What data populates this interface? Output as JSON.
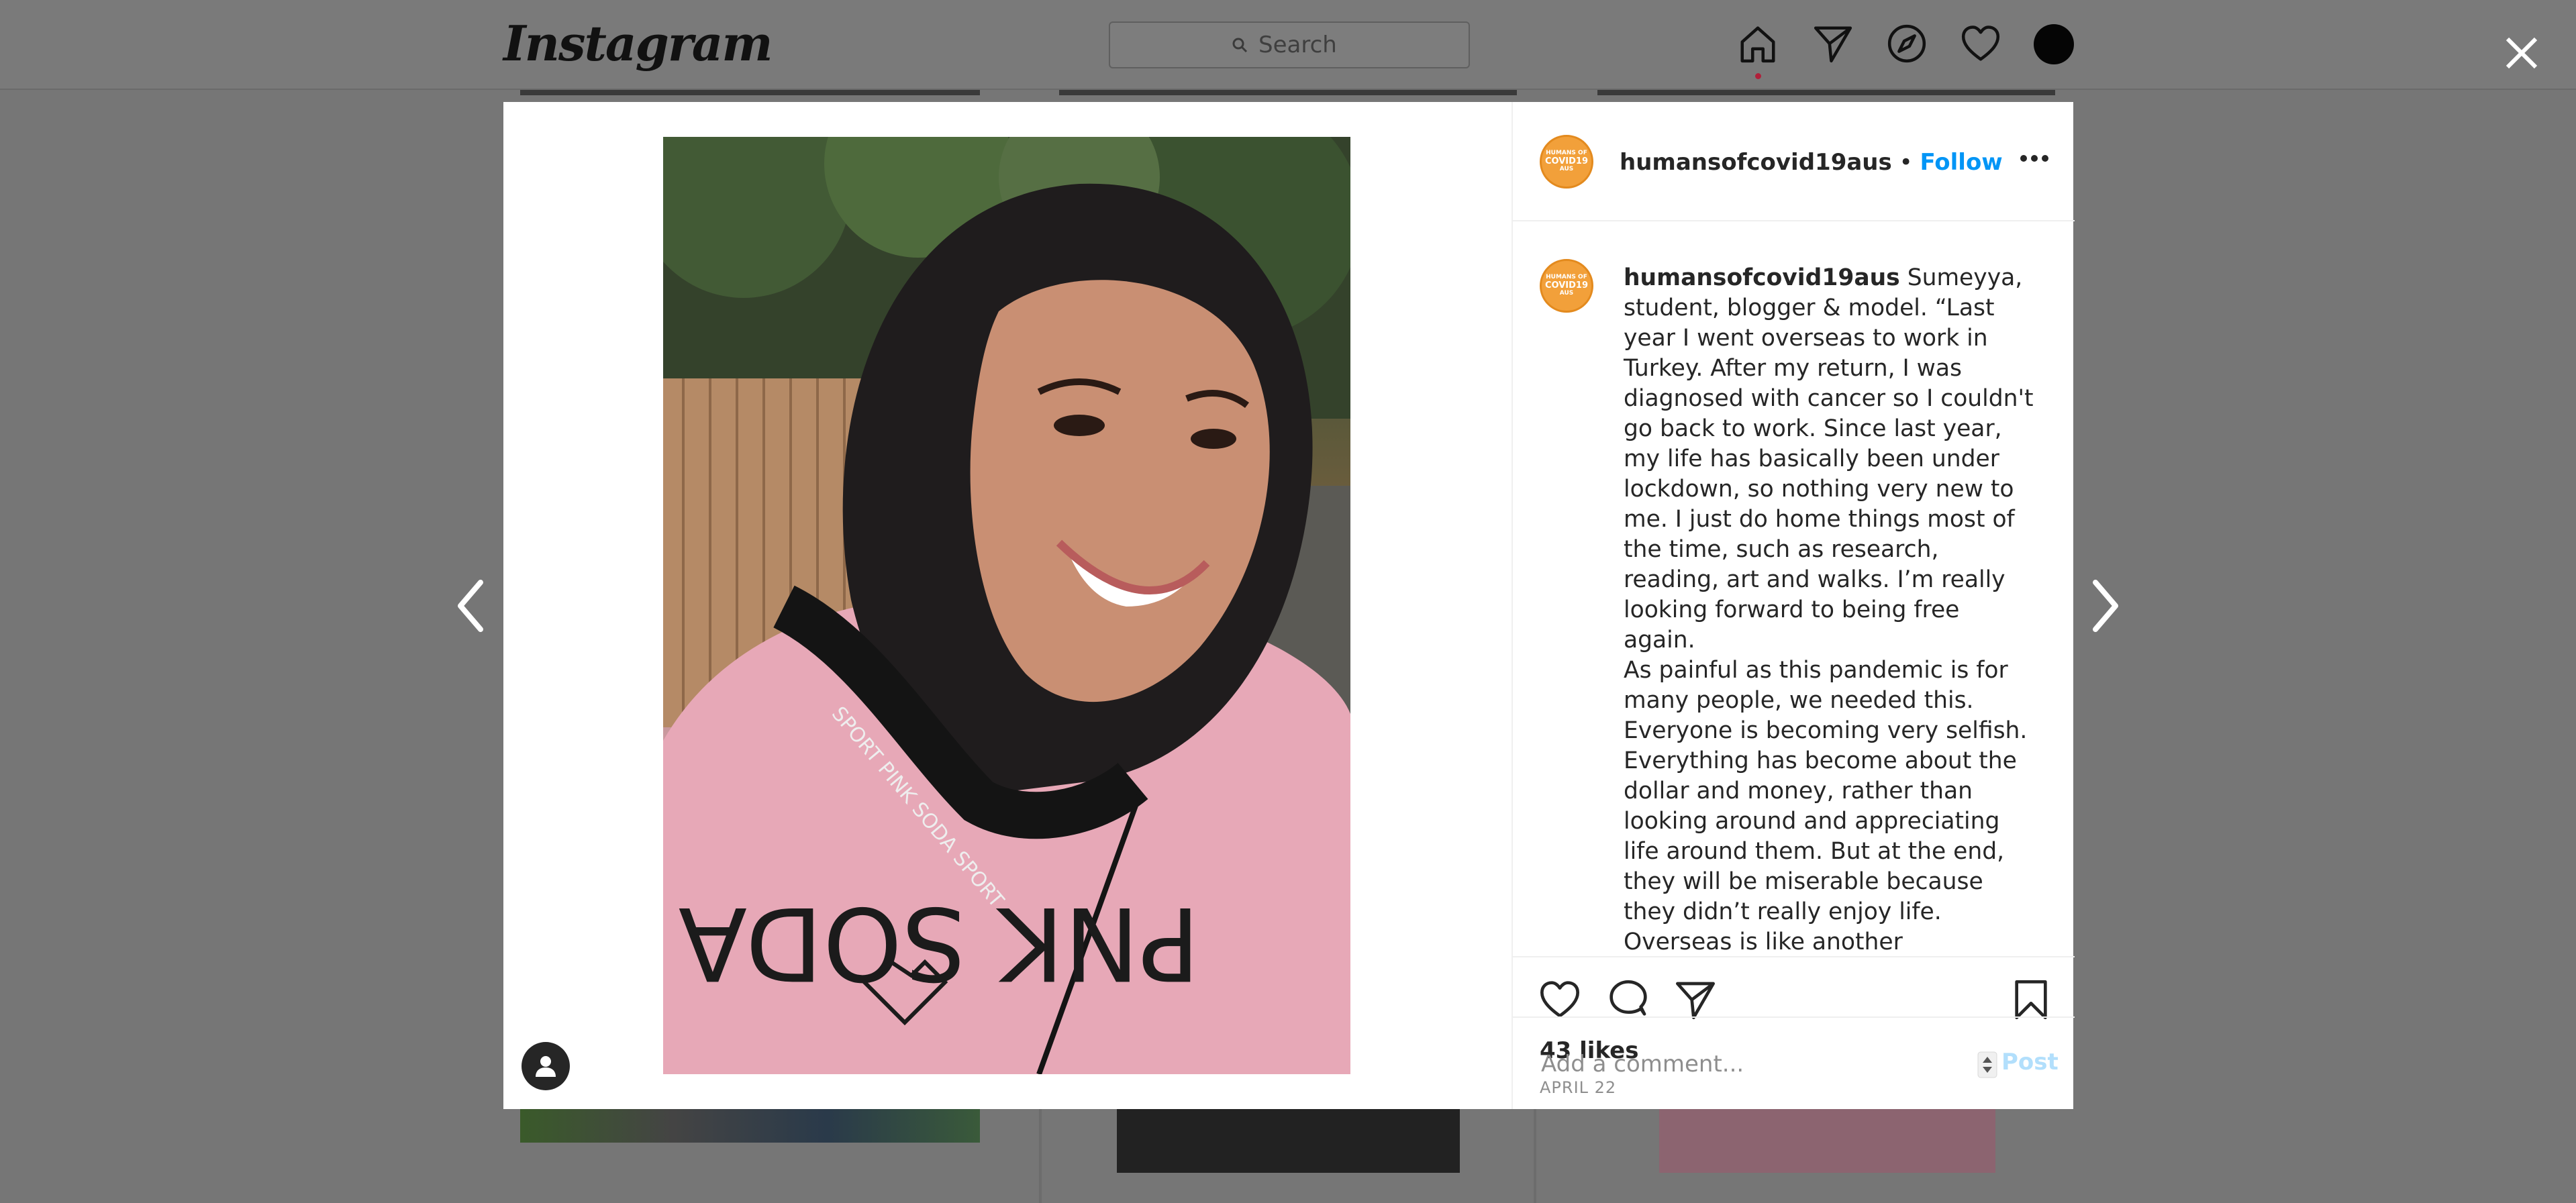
{
  "app": {
    "logo_text": "Instagram",
    "search_placeholder": "Search"
  },
  "nav": {
    "icons": [
      "home-icon",
      "direct-icon",
      "explore-icon",
      "activity-heart-icon",
      "profile-avatar-icon"
    ]
  },
  "post": {
    "username": "humansofcovid19aus",
    "separator": "•",
    "follow_label": "Follow",
    "avatar_text_top": "HUMANS OF",
    "avatar_text_mid": "COVID19",
    "avatar_text_bottom": "AUS",
    "caption_username": "humansofcovid19aus",
    "caption_paragraph_1": "Sumeyya, student, blogger & model. “Last year I went overseas to work in Turkey. After my return, I was diagnosed with cancer so I couldn't go back to work. Since last year, my life has basically been under lockdown, so nothing very new to me. I just do home things most of the time, such as research, reading, art and walks. I’m really looking forward to being free again.",
    "caption_paragraph_2": "As painful as this pandemic is for many people, we needed this. Everyone is becoming very selfish. Everything has become about the dollar and money, rather than looking around and appreciating life around them. But at the end, they will be miserable because they didn’t really enjoy life. Overseas is like another",
    "likes": "43 likes",
    "date": "APRIL 22",
    "comment_placeholder": "Add a comment...",
    "post_label": "Post",
    "photo_hoodie_text": "PNK SODA",
    "photo_strap_text": "SPORT PINK SODA SPORT"
  },
  "colors": {
    "follow_blue": "#0095f6",
    "post_disabled": "#b2dffc",
    "avatar_orange": "#f2a03a",
    "overlay": "#767676"
  }
}
